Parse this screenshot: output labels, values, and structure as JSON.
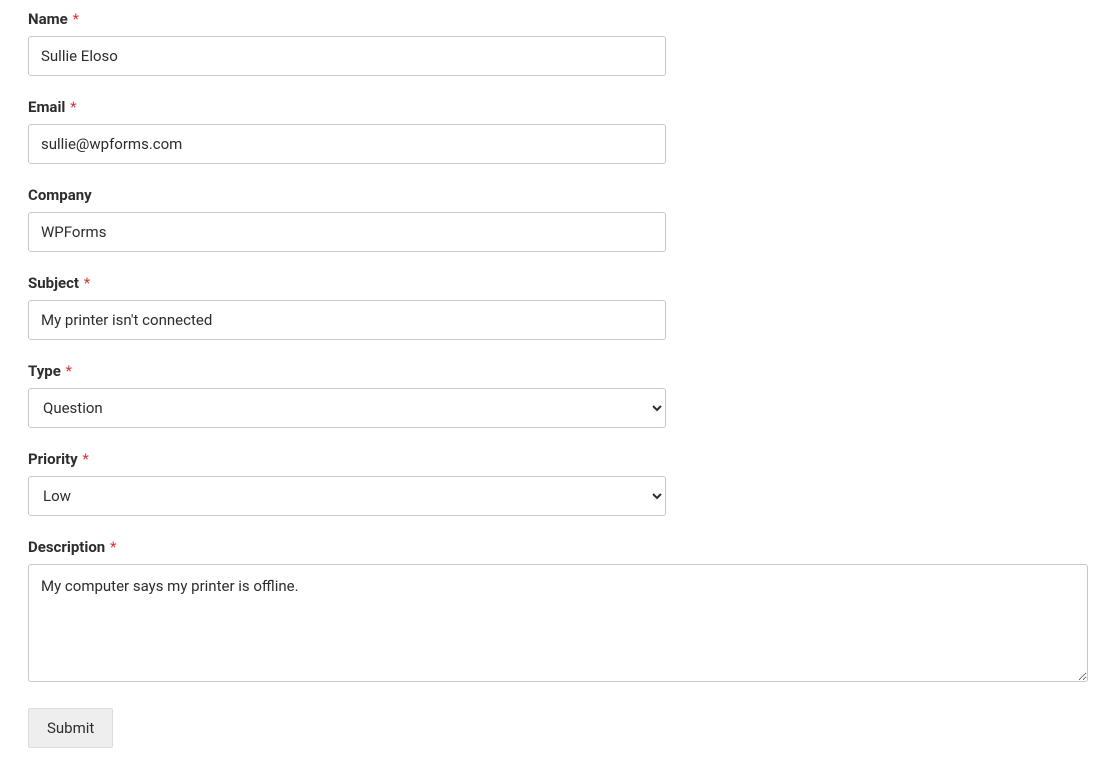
{
  "fields": {
    "name": {
      "label": "Name",
      "required": true,
      "value": "Sullie Eloso"
    },
    "email": {
      "label": "Email",
      "required": true,
      "value": "sullie@wpforms.com"
    },
    "company": {
      "label": "Company",
      "required": false,
      "value": "WPForms"
    },
    "subject": {
      "label": "Subject",
      "required": true,
      "value": "My printer isn't connected"
    },
    "type": {
      "label": "Type",
      "required": true,
      "selected": "Question"
    },
    "priority": {
      "label": "Priority",
      "required": true,
      "selected": "Low"
    },
    "description": {
      "label": "Description",
      "required": true,
      "value": "My computer says my printer is offline."
    }
  },
  "required_mark": "*",
  "submit_label": "Submit"
}
